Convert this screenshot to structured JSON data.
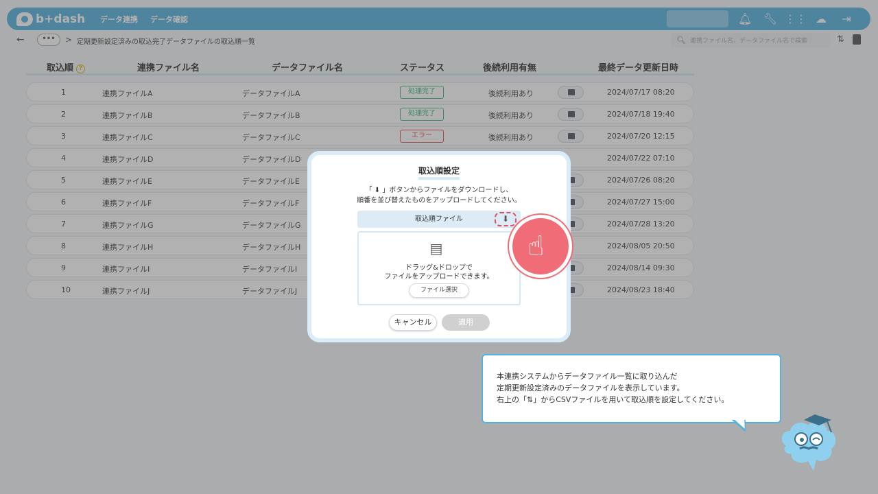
{
  "header": {
    "logo": "b+dash",
    "nav": [
      "データ連携",
      "データ確認"
    ]
  },
  "subbar": {
    "more": "•••",
    "sep": ">",
    "breadcrumb": "定期更新設定済みの取込完了データファイルの取込順一覧",
    "search_placeholder": "連携ファイル名、データファイル名で検索"
  },
  "table": {
    "headers": [
      "取込順",
      "連携ファイル名",
      "データファイル名",
      "ステータス",
      "後続利用有無",
      "最終データ更新日時"
    ],
    "help": "?",
    "rows": [
      {
        "no": "1",
        "link": "連携ファイルA",
        "data": "データファイルA",
        "status": "処理完了",
        "state": "ok",
        "use": "後続利用あり",
        "date": "2024/07/17 08:20"
      },
      {
        "no": "2",
        "link": "連携ファイルB",
        "data": "データファイルB",
        "status": "処理完了",
        "state": "ok",
        "use": "後続利用あり",
        "date": "2024/07/18 19:40"
      },
      {
        "no": "3",
        "link": "連携ファイルC",
        "data": "データファイルC",
        "status": "エラー",
        "state": "err",
        "use": "後続利用あり",
        "date": "2024/07/20 12:15"
      },
      {
        "no": "4",
        "link": "連携ファイルD",
        "data": "データファイルD",
        "status": "",
        "state": "",
        "use": "",
        "date": "2024/07/22 07:10"
      },
      {
        "no": "5",
        "link": "連携ファイルE",
        "data": "データファイルE",
        "status": "",
        "state": "",
        "use": "",
        "date": "2024/07/26 08:20"
      },
      {
        "no": "6",
        "link": "連携ファイルF",
        "data": "データファイルF",
        "status": "",
        "state": "",
        "use": "",
        "date": "2024/07/27 15:00"
      },
      {
        "no": "7",
        "link": "連携ファイルG",
        "data": "データファイルG",
        "status": "",
        "state": "",
        "use": "",
        "date": "2024/07/28 13:20"
      },
      {
        "no": "8",
        "link": "連携ファイルH",
        "data": "データファイルH",
        "status": "",
        "state": "",
        "use": "",
        "date": "2024/08/05 20:50"
      },
      {
        "no": "9",
        "link": "連携ファイルI",
        "data": "データファイルI",
        "status": "",
        "state": "",
        "use": "",
        "date": "2024/08/14 09:30"
      },
      {
        "no": "10",
        "link": "連携ファイルJ",
        "data": "データファイルJ",
        "status": "",
        "state": "",
        "use": "",
        "date": "2024/08/23 18:40"
      }
    ]
  },
  "modal": {
    "title": "取込順設定",
    "desc_line1": "「 ⬇ 」ボタンからファイルをダウンロードし、",
    "desc_line2": "順番を並び替えたものをアップロードしてください。",
    "file_label": "取込順ファイル",
    "drop_line1": "ドラッグ&ドロップで",
    "drop_line2": "ファイルをアップロードできます。",
    "select_label": "ファイル選択",
    "cancel_label": "キャンセル",
    "apply_label": "適用"
  },
  "tip": {
    "line1": "本連携システムからデータファイル一覧に取り込んだ",
    "line2": "定期更新設定済みのデータファイルを表示しています。",
    "line3": "右上の「⇅」からCSVファイルを用いて取込順を設定してください。"
  },
  "colors": {
    "accent": "#55b2df",
    "ok": "#3db87a",
    "err": "#e05050",
    "pointer": "#f06d78"
  }
}
